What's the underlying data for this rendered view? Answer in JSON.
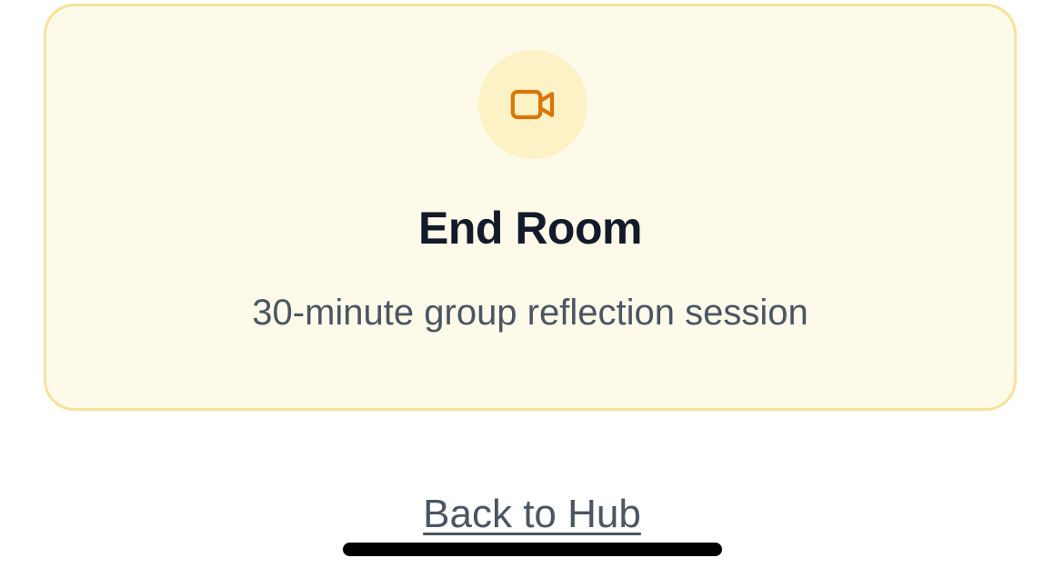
{
  "card": {
    "icon": "video-camera-icon",
    "title": "End Room",
    "subtitle": "30-minute group reflection session",
    "accent_color": "#d97706",
    "background_color": "#fefaea",
    "border_color": "#f7e29a"
  },
  "footer": {
    "back_link_label": "Back to Hub"
  }
}
